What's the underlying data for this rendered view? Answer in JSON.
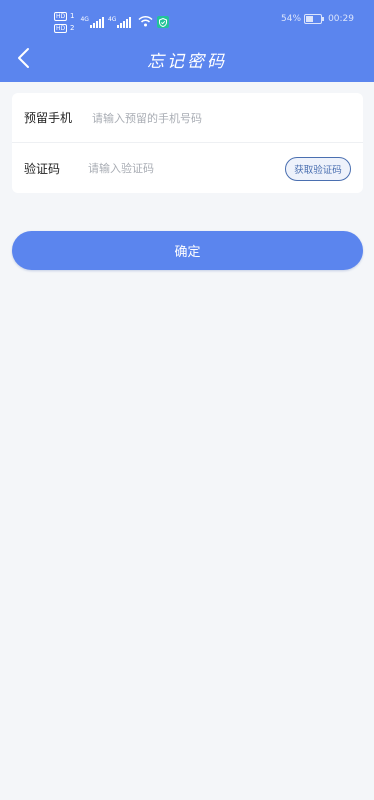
{
  "status_bar": {
    "sim1_tag": "HD",
    "sim2_tag": "HD",
    "sim1_index": "1",
    "sim2_index": "2",
    "network1": "4G",
    "network2": "4G",
    "battery_percent": "54%",
    "battery_level": 0.54,
    "time": "00:29"
  },
  "header": {
    "title": "忘记密码",
    "background_color": "#5b85ee"
  },
  "form": {
    "phone_label": "预留手机",
    "phone_placeholder": "请输入预留的手机号码",
    "code_label": "验证码",
    "code_placeholder": "请输入验证码",
    "get_code_label": "获取验证码"
  },
  "confirm_label": "确定",
  "colors": {
    "accent": "#5b85ee",
    "code_button_border": "#4a6fb0",
    "page_background": "#f4f6f9"
  },
  "icons": [
    "back-arrow-icon",
    "signal-icon",
    "wifi-icon",
    "security-shield-icon",
    "battery-icon"
  ]
}
